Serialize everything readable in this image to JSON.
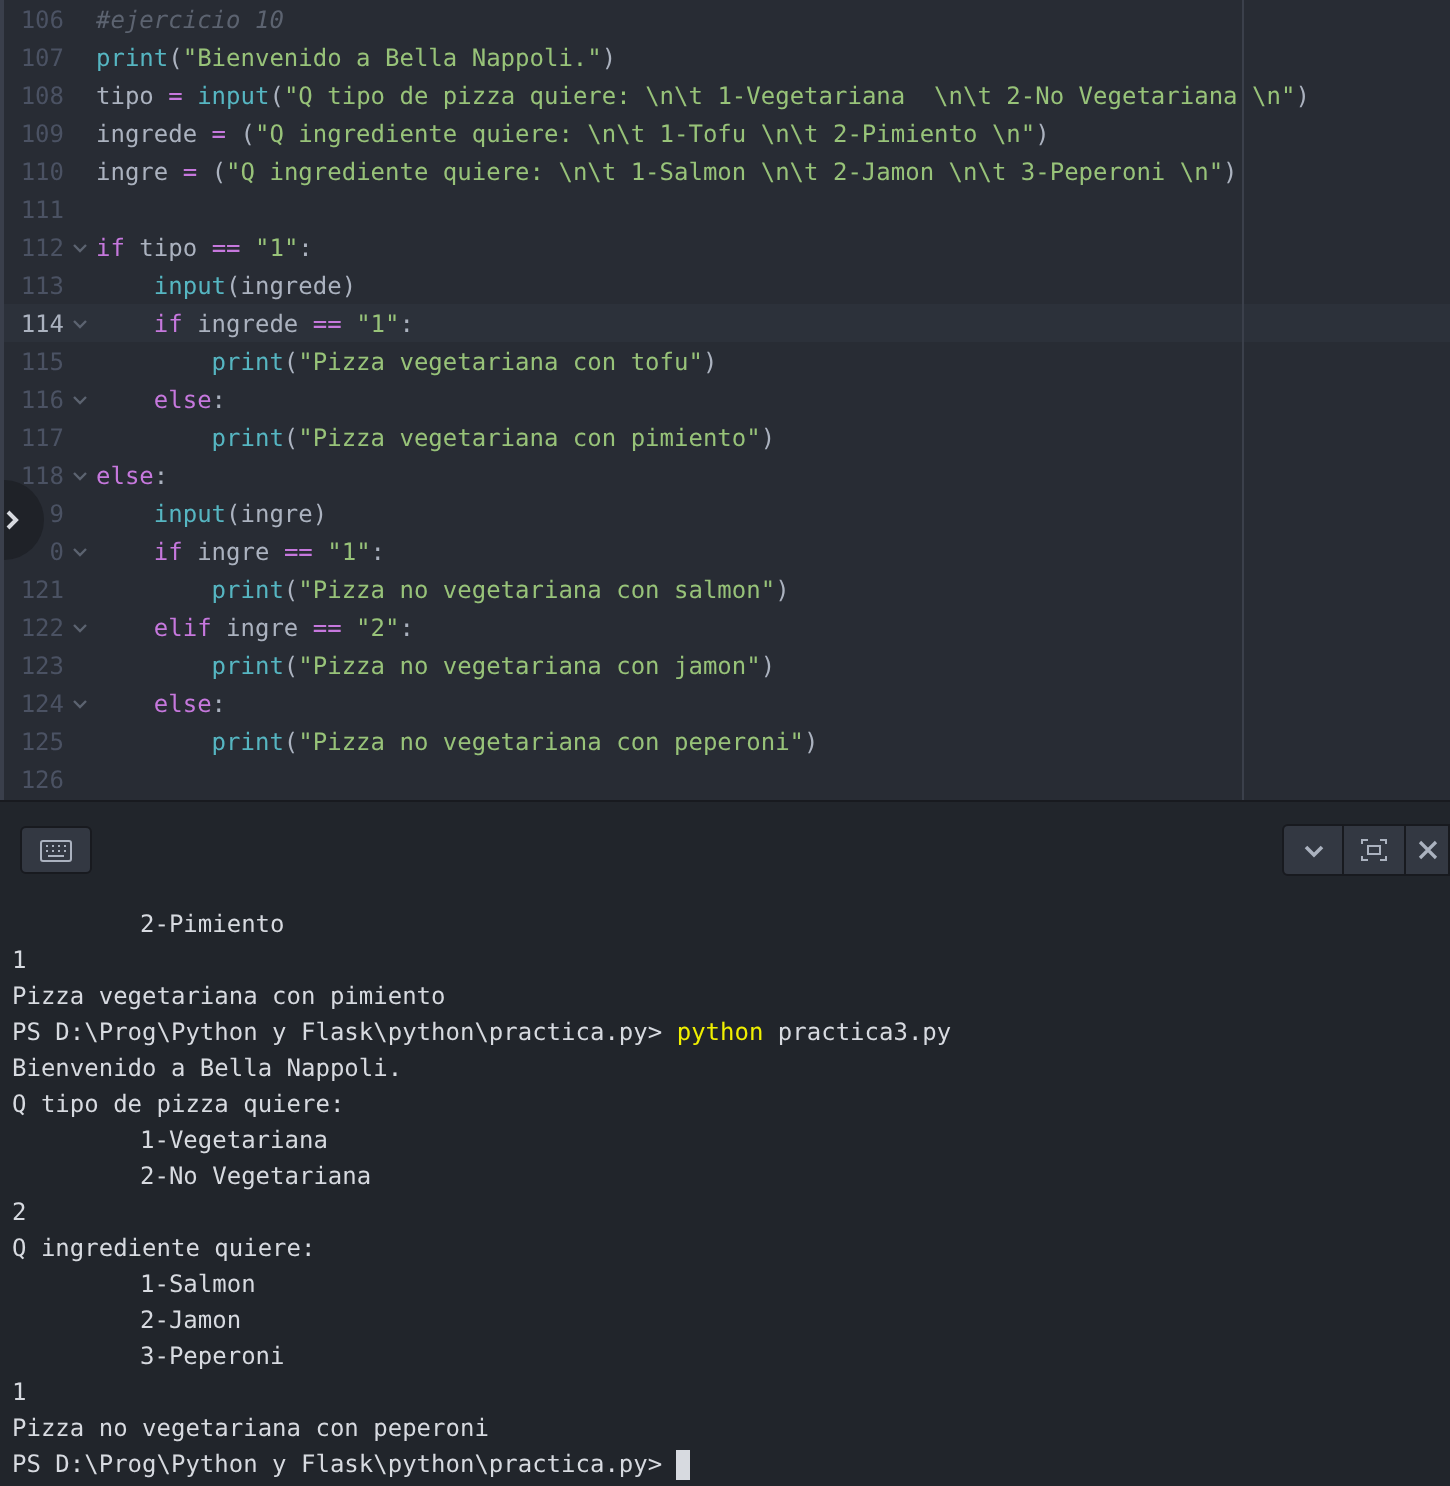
{
  "editor": {
    "lines": [
      {
        "number": "106",
        "fold": false,
        "current": false,
        "tokens": [
          {
            "kind": "comment",
            "text": "#ejercicio 10"
          }
        ]
      },
      {
        "number": "107",
        "fold": false,
        "current": false,
        "tokens": [
          {
            "kind": "func",
            "text": "print"
          },
          {
            "kind": "plain",
            "text": "("
          },
          {
            "kind": "string",
            "text": "\"Bienvenido a Bella Nappoli.\""
          },
          {
            "kind": "plain",
            "text": ")"
          }
        ]
      },
      {
        "number": "108",
        "fold": false,
        "current": false,
        "tokens": [
          {
            "kind": "plain",
            "text": "tipo "
          },
          {
            "kind": "op",
            "text": "="
          },
          {
            "kind": "func",
            "text": " input"
          },
          {
            "kind": "plain",
            "text": "("
          },
          {
            "kind": "string",
            "text": "\"Q tipo de pizza quiere: \\n\\t 1-Vegetariana  \\n\\t 2-No Vegetariana \\n\""
          },
          {
            "kind": "plain",
            "text": ")"
          }
        ]
      },
      {
        "number": "109",
        "fold": false,
        "current": false,
        "tokens": [
          {
            "kind": "plain",
            "text": "ingrede "
          },
          {
            "kind": "op",
            "text": "="
          },
          {
            "kind": "plain",
            "text": " ("
          },
          {
            "kind": "string",
            "text": "\"Q ingrediente quiere: \\n\\t 1-Tofu \\n\\t 2-Pimiento \\n\""
          },
          {
            "kind": "plain",
            "text": ")"
          }
        ]
      },
      {
        "number": "110",
        "fold": false,
        "current": false,
        "tokens": [
          {
            "kind": "plain",
            "text": "ingre "
          },
          {
            "kind": "op",
            "text": "="
          },
          {
            "kind": "plain",
            "text": " ("
          },
          {
            "kind": "string",
            "text": "\"Q ingrediente quiere: \\n\\t 1-Salmon \\n\\t 2-Jamon \\n\\t 3-Peperoni \\n\""
          },
          {
            "kind": "plain",
            "text": ")"
          }
        ]
      },
      {
        "number": "111",
        "fold": false,
        "current": false
      },
      {
        "number": "112",
        "fold": true,
        "current": false,
        "tokens": [
          {
            "kind": "keyword",
            "text": "if"
          },
          {
            "kind": "plain",
            "text": " tipo "
          },
          {
            "kind": "op",
            "text": "=="
          },
          {
            "kind": "string",
            "text": " \"1\""
          },
          {
            "kind": "plain",
            "text": ":"
          }
        ]
      },
      {
        "number": "113",
        "fold": false,
        "current": false,
        "tokens": [
          {
            "kind": "func",
            "text": "    input"
          },
          {
            "kind": "plain",
            "text": "(ingrede)"
          }
        ]
      },
      {
        "number": "114",
        "fold": true,
        "current": true,
        "tokens": [
          {
            "kind": "keyword",
            "text": "    if"
          },
          {
            "kind": "plain",
            "text": " ingrede "
          },
          {
            "kind": "op",
            "text": "=="
          },
          {
            "kind": "string",
            "text": " \"1\""
          },
          {
            "kind": "plain",
            "text": ":"
          }
        ]
      },
      {
        "number": "115",
        "fold": false,
        "current": false,
        "tokens": [
          {
            "kind": "func",
            "text": "        print"
          },
          {
            "kind": "plain",
            "text": "("
          },
          {
            "kind": "string",
            "text": "\"Pizza vegetariana con tofu\""
          },
          {
            "kind": "plain",
            "text": ")"
          }
        ]
      },
      {
        "number": "116",
        "fold": true,
        "current": false,
        "tokens": [
          {
            "kind": "keyword",
            "text": "    else"
          },
          {
            "kind": "plain",
            "text": ":"
          }
        ]
      },
      {
        "number": "117",
        "fold": false,
        "current": false,
        "tokens": [
          {
            "kind": "func",
            "text": "        print"
          },
          {
            "kind": "plain",
            "text": "("
          },
          {
            "kind": "string",
            "text": "\"Pizza vegetariana con pimiento\""
          },
          {
            "kind": "plain",
            "text": ")"
          }
        ]
      },
      {
        "number": "118",
        "fold": true,
        "current": false,
        "tokens": [
          {
            "kind": "keyword",
            "text": "else"
          },
          {
            "kind": "plain",
            "text": ":"
          }
        ]
      },
      {
        "number": "9",
        "fold": false,
        "current": false,
        "tokens": [
          {
            "kind": "func",
            "text": "    input"
          },
          {
            "kind": "plain",
            "text": "(ingre)"
          }
        ]
      },
      {
        "number": "0",
        "fold": true,
        "current": false,
        "tokens": [
          {
            "kind": "keyword",
            "text": "    if"
          },
          {
            "kind": "plain",
            "text": " ingre "
          },
          {
            "kind": "op",
            "text": "=="
          },
          {
            "kind": "string",
            "text": " \"1\""
          },
          {
            "kind": "plain",
            "text": ":"
          }
        ]
      },
      {
        "number": "121",
        "fold": false,
        "current": false,
        "tokens": [
          {
            "kind": "func",
            "text": "        print"
          },
          {
            "kind": "plain",
            "text": "("
          },
          {
            "kind": "string",
            "text": "\"Pizza no vegetariana con salmon\""
          },
          {
            "kind": "plain",
            "text": ")"
          }
        ]
      },
      {
        "number": "122",
        "fold": true,
        "current": false,
        "tokens": [
          {
            "kind": "keyword",
            "text": "    elif"
          },
          {
            "kind": "plain",
            "text": " ingre "
          },
          {
            "kind": "op",
            "text": "=="
          },
          {
            "kind": "string",
            "text": " \"2\""
          },
          {
            "kind": "plain",
            "text": ":"
          }
        ]
      },
      {
        "number": "123",
        "fold": false,
        "current": false,
        "tokens": [
          {
            "kind": "func",
            "text": "        print"
          },
          {
            "kind": "plain",
            "text": "("
          },
          {
            "kind": "string",
            "text": "\"Pizza no vegetariana con jamon\""
          },
          {
            "kind": "plain",
            "text": ")"
          }
        ]
      },
      {
        "number": "124",
        "fold": true,
        "current": false,
        "tokens": [
          {
            "kind": "keyword",
            "text": "    else"
          },
          {
            "kind": "plain",
            "text": ":"
          }
        ]
      },
      {
        "number": "125",
        "fold": false,
        "current": false,
        "tokens": [
          {
            "kind": "func",
            "text": "        print"
          },
          {
            "kind": "plain",
            "text": "("
          },
          {
            "kind": "string",
            "text": "\"Pizza no vegetariana con peperoni\""
          },
          {
            "kind": "plain",
            "text": ")"
          }
        ]
      },
      {
        "number": "126",
        "fold": false,
        "current": false
      }
    ]
  },
  "terminal": {
    "lines": [
      {
        "indented": true,
        "parts": [
          {
            "kind": "out",
            "text": "2-Pimiento"
          }
        ]
      },
      {
        "indented": false,
        "parts": [
          {
            "kind": "out",
            "text": "1"
          }
        ]
      },
      {
        "indented": false,
        "parts": [
          {
            "kind": "out",
            "text": "Pizza vegetariana con pimiento"
          }
        ]
      },
      {
        "indented": false,
        "parts": [
          {
            "kind": "out",
            "text": "PS D:\\Prog\\Python y Flask\\python\\practica.py> "
          },
          {
            "kind": "cmd",
            "text": "python"
          },
          {
            "kind": "out",
            "text": " practica3.py"
          }
        ]
      },
      {
        "indented": false,
        "parts": [
          {
            "kind": "out",
            "text": "Bienvenido a Bella Nappoli."
          }
        ]
      },
      {
        "indented": false,
        "parts": [
          {
            "kind": "out",
            "text": "Q tipo de pizza quiere:"
          }
        ]
      },
      {
        "indented": true,
        "parts": [
          {
            "kind": "out",
            "text": "1-Vegetariana"
          }
        ]
      },
      {
        "indented": true,
        "parts": [
          {
            "kind": "out",
            "text": "2-No Vegetariana"
          }
        ]
      },
      {
        "indented": false,
        "parts": [
          {
            "kind": "out",
            "text": "2"
          }
        ]
      },
      {
        "indented": false,
        "parts": [
          {
            "kind": "out",
            "text": "Q ingrediente quiere:"
          }
        ]
      },
      {
        "indented": true,
        "parts": [
          {
            "kind": "out",
            "text": "1-Salmon"
          }
        ]
      },
      {
        "indented": true,
        "parts": [
          {
            "kind": "out",
            "text": "2-Jamon"
          }
        ]
      },
      {
        "indented": true,
        "parts": [
          {
            "kind": "out",
            "text": "3-Peperoni"
          }
        ]
      },
      {
        "indented": false,
        "parts": [
          {
            "kind": "out",
            "text": "1"
          }
        ]
      },
      {
        "indented": false,
        "parts": [
          {
            "kind": "out",
            "text": "Pizza no vegetariana con peperoni"
          }
        ]
      },
      {
        "indented": false,
        "cursor": true,
        "parts": [
          {
            "kind": "out",
            "text": "PS D:\\Prog\\Python y Flask\\python\\practica.py>"
          }
        ]
      }
    ]
  }
}
